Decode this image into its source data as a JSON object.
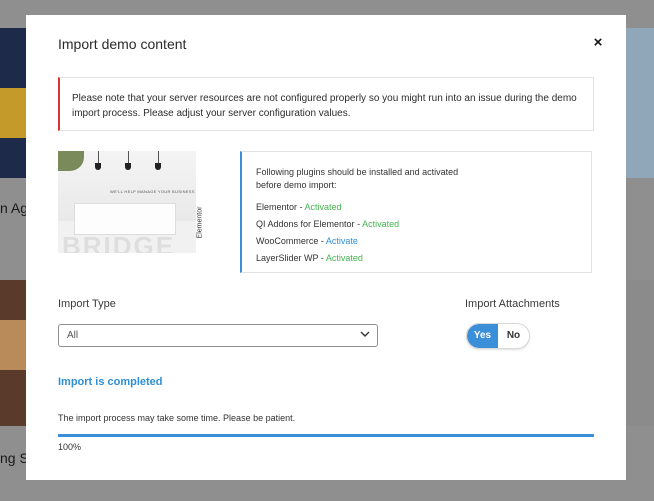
{
  "background": {
    "text_1": "n Ag",
    "text_2": "ng S"
  },
  "modal": {
    "title": "Import demo content",
    "close_symbol": "×",
    "notice": "Please note that your server resources are not configured properly so you might run into an issue during the demo import process. Please adjust your server configuration values.",
    "preview": {
      "headline": "WE'LL HELP MANAGE YOUR BUSINESS",
      "big_word": "BRIDGE",
      "brand": "Elementor"
    },
    "plugins": {
      "intro": "Following plugins should be installed and activated before demo import:",
      "items": [
        {
          "name": "Elementor",
          "separator": " - ",
          "status": "Activated"
        },
        {
          "name": "QI Addons for Elementor",
          "separator": " - ",
          "status": "Activated"
        },
        {
          "name": "WooCommerce",
          "separator": " - ",
          "status": "Activate"
        },
        {
          "name": "LayerSlider WP",
          "separator": " - ",
          "status": "Activated"
        }
      ]
    },
    "import_type": {
      "label": "Import Type",
      "selected": "All",
      "chevron_icon": "chevron-down-icon"
    },
    "import_attachments": {
      "label": "Import Attachments",
      "yes_label": "Yes",
      "no_label": "No",
      "selected": "Yes"
    },
    "status_message": "Import is completed",
    "patience_text": "The import process may take some time. Please be patient.",
    "progress": {
      "percent": 100,
      "label": "100%"
    }
  },
  "colors": {
    "accent": "#3b8ed8",
    "error_border": "#d63638",
    "activated": "#46b450",
    "activate_link": "#2f8fd6"
  }
}
